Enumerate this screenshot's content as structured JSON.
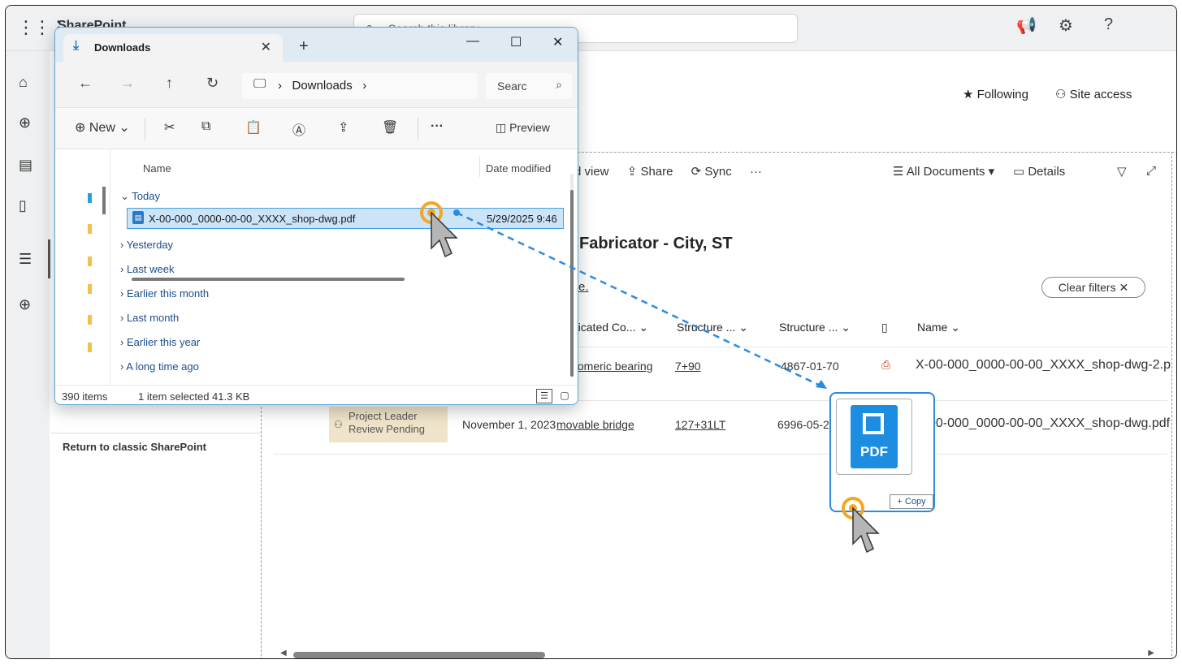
{
  "sharepoint": {
    "brand": "SharePoint",
    "search_placeholder": "Search this library",
    "following": "Following",
    "site_access": "Site access",
    "cmd_view": "d view",
    "cmd_share": "Share",
    "cmd_sync": "Sync",
    "cmd_more": "···",
    "all_documents": "All Documents",
    "details": "Details",
    "library_title": "Fabricator - City, ST",
    "library_link": "re.",
    "clear_filters": "Clear filters",
    "columns": {
      "fabricated": "ricated Co...",
      "structure1": "Structure ...",
      "structure2": "Structure ...",
      "name": "Name"
    },
    "rows": [
      {
        "component": "tomeric bearing",
        "structure_no": "7+90",
        "structure_id": "4867-01-70",
        "name": "X-00-000_0000-00-00_XXXX_shop-dwg-2.p"
      },
      {
        "status_line1": "Project Leader",
        "status_line2": "Review Pending",
        "date": "November 1, 2023",
        "component": "movable bridge",
        "structure_no": "127+31LT",
        "structure_id": "6996-05-28",
        "name": "X-00-000_0000-00-00_XXXX_shop-dwg.pdf"
      }
    ],
    "return_classic": "Return to classic SharePoint"
  },
  "explorer": {
    "tab_title": "Downloads",
    "address_segment": "Downloads",
    "search_text": "Searc",
    "toolbar_new": "New",
    "toolbar_preview": "Preview",
    "col_name": "Name",
    "col_date": "Date modified",
    "groups": [
      "Today",
      "Yesterday",
      "Last week",
      "Earlier this month",
      "Last month",
      "Earlier this year",
      "A long time ago"
    ],
    "selected_file": "X-00-000_0000-00-00_XXXX_shop-dwg.pdf",
    "selected_date": "5/29/2025 9:46",
    "status_items": "390 items",
    "status_selected": "1 item selected  41.3 KB"
  },
  "drag": {
    "thumb_label": "PDF",
    "copy_label": "+ Copy",
    "accent": "#2b8be0",
    "cursor_ring": "#f5a623"
  }
}
